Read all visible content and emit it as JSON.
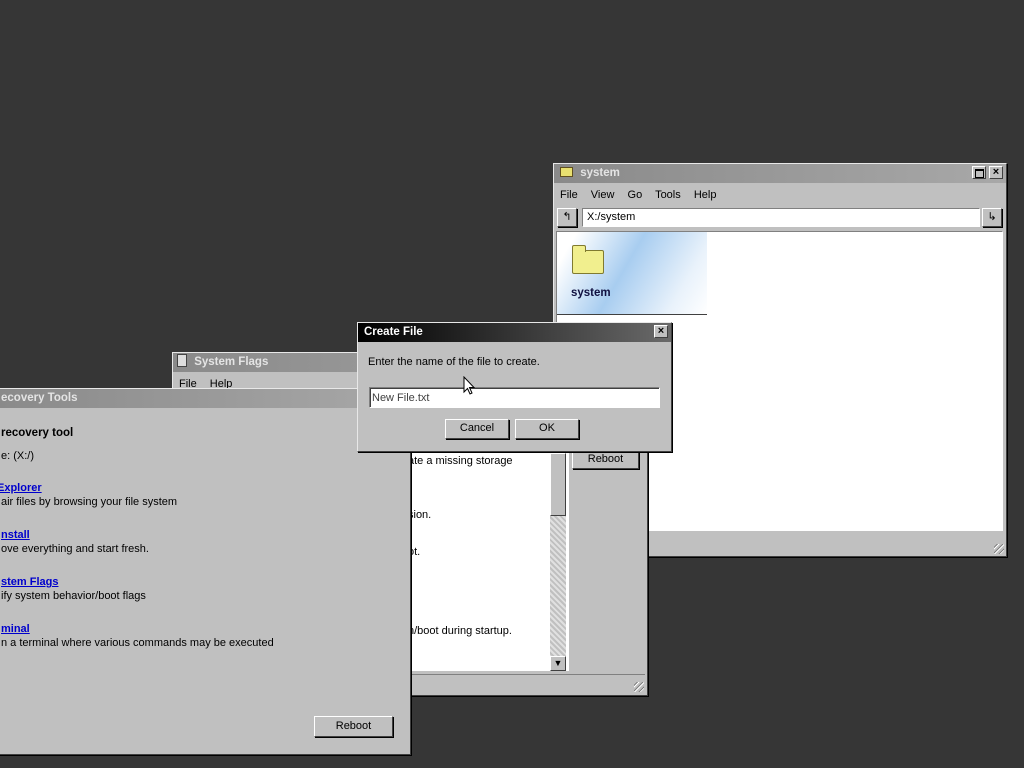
{
  "recovery_window": {
    "title": "ecovery Tools",
    "heading": "recovery tool",
    "drive_line": "e: (X:/)",
    "items": [
      {
        "link": " Explorer",
        "desc": "air files by browsing your file system"
      },
      {
        "link": "nstall",
        "desc": "ove everything and start fresh."
      },
      {
        "link": "stem Flags",
        "desc": "ify system behavior/boot flags"
      },
      {
        "link": "minal",
        "desc": "n a terminal where various commands may be executed"
      }
    ],
    "reboot_label": "Reboot"
  },
  "flags_window": {
    "title": "System Flags",
    "menu": [
      "File",
      "Help"
    ],
    "lines": [
      "ate a missing storage",
      "sion.",
      "ot.",
      "n/boot during startup."
    ],
    "reboot_label": "Reboot"
  },
  "explorer_window": {
    "title": "system",
    "menu": [
      "File",
      "View",
      "Go",
      "Tools",
      "Help"
    ],
    "address": "X:/system",
    "folder_name": "system"
  },
  "dialog": {
    "title": "Create File",
    "prompt": "Enter the name of the file to create.",
    "input_value": "New File.txt",
    "cancel_label": "Cancel",
    "ok_label": "OK"
  },
  "icons": [
    "wrench-icon",
    "folder-icon",
    "up-arrow-icon",
    "go-arrow-icon",
    "maximize-icon",
    "close-icon",
    "scroll-down-icon",
    "size-grip-icon",
    "mouse-cursor-icon"
  ]
}
